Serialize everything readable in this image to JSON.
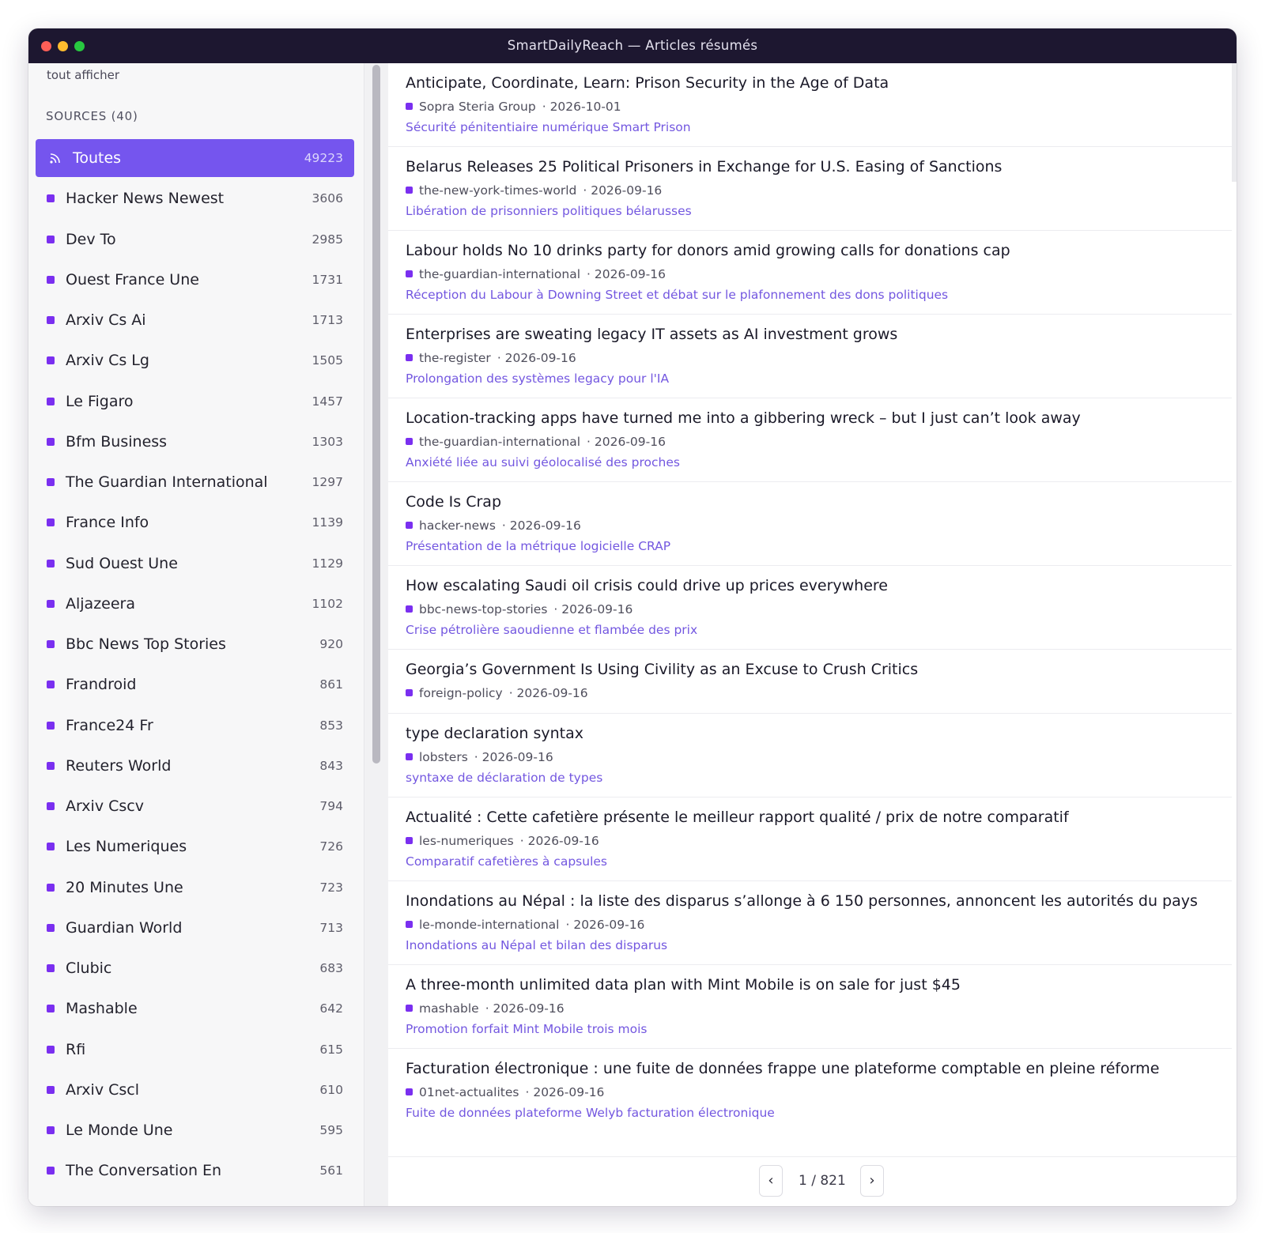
{
  "window": {
    "title": "SmartDailyReach — Articles résumés",
    "traffic_lights": [
      "#ff5f57",
      "#febc2e",
      "#28c840"
    ]
  },
  "sidebar": {
    "show_all": "tout afficher",
    "sources_heading": "SOURCES (40)",
    "accent": "#7555ee",
    "bullet_color": "#7a2ff0",
    "items": [
      {
        "label": "Toutes",
        "count": "49223",
        "icon": "rss-icon",
        "active": true
      },
      {
        "label": "Hacker News Newest",
        "count": "3606"
      },
      {
        "label": "Dev To",
        "count": "2985"
      },
      {
        "label": "Ouest France Une",
        "count": "1731"
      },
      {
        "label": "Arxiv Cs Ai",
        "count": "1713"
      },
      {
        "label": "Arxiv Cs Lg",
        "count": "1505"
      },
      {
        "label": "Le Figaro",
        "count": "1457"
      },
      {
        "label": "Bfm Business",
        "count": "1303"
      },
      {
        "label": "The Guardian International",
        "count": "1297"
      },
      {
        "label": "France Info",
        "count": "1139"
      },
      {
        "label": "Sud Ouest Une",
        "count": "1129"
      },
      {
        "label": "Aljazeera",
        "count": "1102"
      },
      {
        "label": "Bbc News Top Stories",
        "count": "920"
      },
      {
        "label": "Frandroid",
        "count": "861"
      },
      {
        "label": "France24 Fr",
        "count": "853"
      },
      {
        "label": "Reuters World",
        "count": "843"
      },
      {
        "label": "Arxiv Cscv",
        "count": "794"
      },
      {
        "label": "Les Numeriques",
        "count": "726"
      },
      {
        "label": "20 Minutes Une",
        "count": "723"
      },
      {
        "label": "Guardian World",
        "count": "713"
      },
      {
        "label": "Clubic",
        "count": "683"
      },
      {
        "label": "Mashable",
        "count": "642"
      },
      {
        "label": "Rfi",
        "count": "615"
      },
      {
        "label": "Arxiv Cscl",
        "count": "610"
      },
      {
        "label": "Le Monde Une",
        "count": "595"
      },
      {
        "label": "The Conversation En",
        "count": "561"
      }
    ]
  },
  "articles": [
    {
      "title": "Anticipate, Coordinate, Learn: Prison Security in the Age of Data",
      "source": "Sopra Steria Group",
      "date": "· 2026-10-01",
      "summary": "Sécurité pénitentiaire numérique Smart Prison"
    },
    {
      "title": "Belarus Releases 25 Political Prisoners in Exchange for U.S. Easing of Sanctions",
      "source": "the-new-york-times-world",
      "date": "· 2026-09-16",
      "summary": "Libération de prisonniers politiques bélarusses"
    },
    {
      "title": "Labour holds No 10 drinks party for donors amid growing calls for donations cap",
      "source": "the-guardian-international",
      "date": "· 2026-09-16",
      "summary": "Réception du Labour à Downing Street et débat sur le plafonnement des dons politiques"
    },
    {
      "title": "Enterprises are sweating legacy IT assets as AI investment grows",
      "source": "the-register",
      "date": "· 2026-09-16",
      "summary": "Prolongation des systèmes legacy pour l'IA"
    },
    {
      "title": "Location-tracking apps have turned me into a gibbering wreck – but I just can’t look away",
      "source": "the-guardian-international",
      "date": "· 2026-09-16",
      "summary": "Anxiété liée au suivi géolocalisé des proches"
    },
    {
      "title": "Code Is Crap",
      "source": "hacker-news",
      "date": "· 2026-09-16",
      "summary": "Présentation de la métrique logicielle CRAP"
    },
    {
      "title": "How escalating Saudi oil crisis could drive up prices everywhere",
      "source": "bbc-news-top-stories",
      "date": "· 2026-09-16",
      "summary": "Crise pétrolière saoudienne et flambée des prix"
    },
    {
      "title": "Georgia’s Government Is Using Civility as an Excuse to Crush Critics",
      "source": "foreign-policy",
      "date": "· 2026-09-16",
      "summary": ""
    },
    {
      "title": "type declaration syntax",
      "source": "lobsters",
      "date": "· 2026-09-16",
      "summary": "syntaxe de déclaration de types"
    },
    {
      "title": "Actualité : Cette cafetière présente le meilleur rapport qualité / prix de notre comparatif",
      "source": "les-numeriques",
      "date": "· 2026-09-16",
      "summary": "Comparatif cafetières à capsules"
    },
    {
      "title": "Inondations au Népal : la liste des disparus s’allonge à 6 150 personnes, annoncent les autorités du pays",
      "source": "le-monde-international",
      "date": "· 2026-09-16",
      "summary": "Inondations au Népal et bilan des disparus"
    },
    {
      "title": "A three-month unlimited data plan with Mint Mobile is on sale for just $45",
      "source": "mashable",
      "date": "· 2026-09-16",
      "summary": "Promotion forfait Mint Mobile trois mois"
    },
    {
      "title": "Facturation électronique : une fuite de données frappe une plateforme comptable en pleine réforme",
      "source": "01net-actualites",
      "date": "· 2026-09-16",
      "summary": "Fuite de données plateforme Welyb facturation électronique"
    }
  ],
  "pagination": {
    "prev": "‹",
    "page": "1 / 821",
    "next": "›"
  }
}
